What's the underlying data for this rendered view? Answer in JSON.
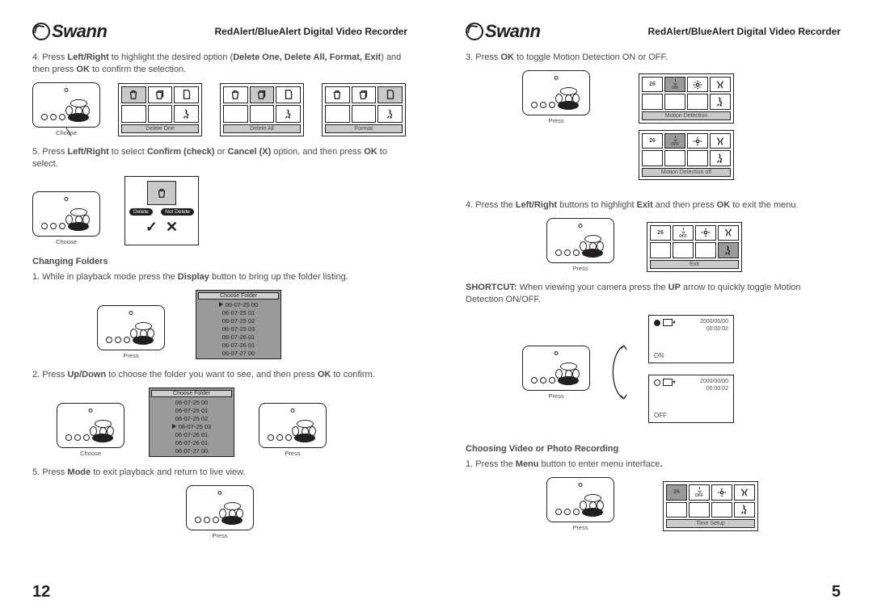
{
  "brand": "Swann",
  "doc_title": "RedAlert/BlueAlert Digital Video Recorder",
  "left": {
    "pagenum": "12",
    "step4": "4. Press <b>Left/Right</b> to highlight the desired option (<b>Delete One, Delete All, Format, Exit</b>) and then press <b>OK</b> to confirm the selection.",
    "step5": "5. Press <b>Left/Right</b> to select <b>Confirm (check)</b> or <b>Cancel (X)</b> option, and then press <b>OK</b> to select.",
    "h_changing": "Changing Folders",
    "cf1": "1. While in playback mode press the <b>Display</b> button to bring up the folder listing.",
    "cf2": "2. Press <b>Up/Down</b> to choose the folder you want to see, and then press <b>OK</b> to confirm.",
    "cf3": "5. Press <b>Mode</b> to exit playback and return to live view.",
    "menubar": {
      "del1": "Delete One",
      "delall": "Delete All",
      "format": "Format"
    },
    "remote_choose": "Choose",
    "remote_press": "Press",
    "confirm": {
      "del": "Delete",
      "notdel": "Not Delete"
    },
    "folders": {
      "title": "Choose Folder",
      "rows": [
        "06-07-25 00",
        "06-07-25 01",
        "06-07-25 02",
        "06-07-25 03",
        "06-07-26 01",
        "06-07-26 01",
        "06-07-27 00"
      ]
    }
  },
  "right": {
    "pagenum": "5",
    "r3": "3. Press <b>OK</b> to toggle Motion Detection ON or OFF.",
    "r4": "4. Press the <b>Left/Right</b> buttons to highlight <b>Exit</b> and then press <b>OK</b> to exit the menu.",
    "shortcut": "<b>SHORTCUT:</b> When viewing your camera press the <b>UP</b> arrow to quickly toggle Motion Detection ON/OFF.",
    "h_choose": "Choosing Video or Photo Recording",
    "c1": "1. Press the <b>Menu</b> button to enter menu interface<b>.</b>",
    "menubar": {
      "motion": "Motion Detection",
      "motion_off": "Motion Detection off",
      "exit": "Exit",
      "time": "Time Setup"
    },
    "badge": {
      "num": "26",
      "on": "ON",
      "off": "OFF"
    },
    "live": {
      "date": "2000/00/00",
      "time": "00:00:02",
      "on": "ON",
      "off": "OFF"
    },
    "remote_press": "Press"
  }
}
